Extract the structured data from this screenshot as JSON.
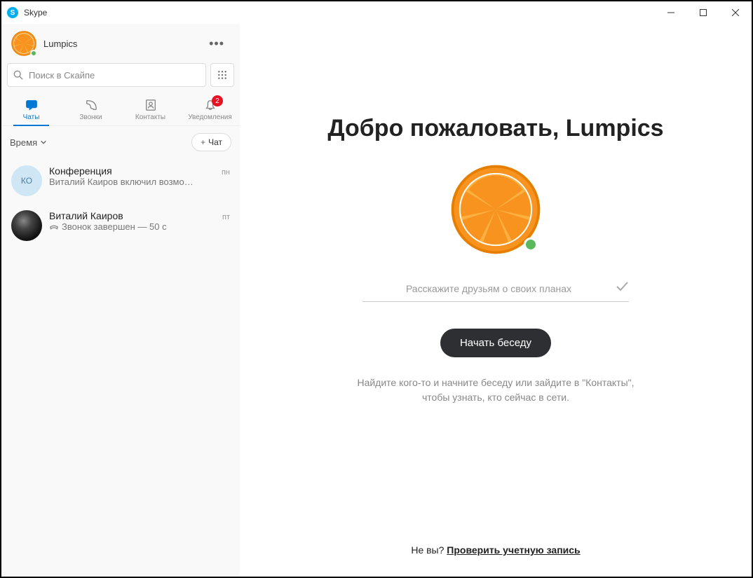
{
  "titlebar": {
    "app_name": "Skype"
  },
  "profile": {
    "name": "Lumpics"
  },
  "search": {
    "placeholder": "Поиск в Скайпе"
  },
  "tabs": {
    "chats": "Чаты",
    "calls": "Звонки",
    "contacts": "Контакты",
    "notifications": "Уведомления",
    "notif_badge": "2"
  },
  "filter": {
    "time_label": "Время",
    "new_chat_label": "Чат"
  },
  "chats": [
    {
      "initials": "КО",
      "title": "Конференция",
      "preview": "Виталий Каиров включил возмо…",
      "time": "пн"
    },
    {
      "title": "Виталий Каиров",
      "preview": "Звонок завершен — 50 с",
      "time": "пт"
    }
  ],
  "main": {
    "welcome": "Добро пожаловать, Lumpics",
    "mood_placeholder": "Расскажите друзьям о своих планах",
    "start_button": "Начать беседу",
    "helper": "Найдите кого-то и начните беседу или зайдите в \"Контакты\", чтобы узнать, кто сейчас в сети.",
    "not_you": "Не вы?",
    "check_account": "Проверить учетную запись"
  }
}
